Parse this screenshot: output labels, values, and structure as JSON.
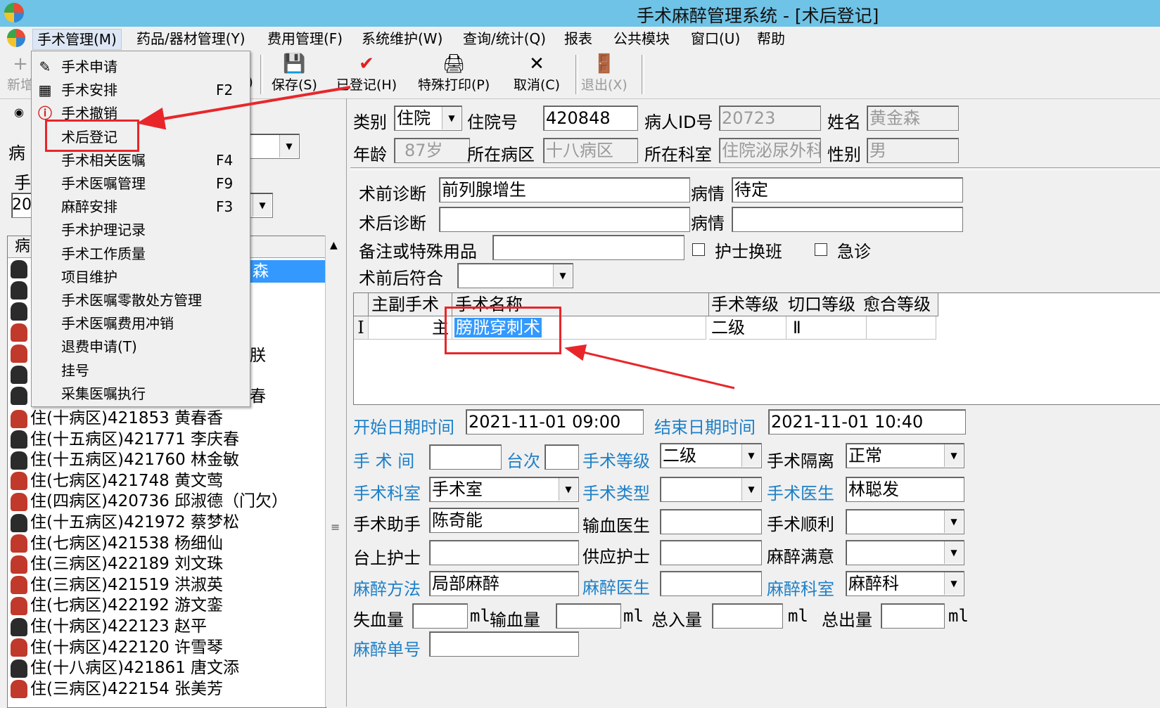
{
  "window": {
    "title": "手术麻醉管理系统 - [术后登记]"
  },
  "menubar": {
    "items": [
      "手术管理(M)",
      "药品/器材管理(Y)",
      "费用管理(F)",
      "系统维护(W)",
      "查询/统计(Q)",
      "报表",
      "公共模块",
      "窗口(U)",
      "帮助"
    ]
  },
  "toolbar": {
    "new_label": "新增",
    "edit_partial": ")",
    "save_label": "保存(S)",
    "registered_label": "已登记(H)",
    "special_print_label": "特殊打印(P)",
    "cancel_label": "取消(C)",
    "exit_label": "退出(X)"
  },
  "dropdown": {
    "items": [
      {
        "label": "手术申请",
        "shortcut": "",
        "icon": "pen-icon"
      },
      {
        "label": "手术安排",
        "shortcut": "F2",
        "icon": "qr-icon"
      },
      {
        "label": "手术撤销",
        "shortcut": "",
        "icon": "alert-icon"
      },
      {
        "label": "术后登记",
        "shortcut": "",
        "icon": ""
      },
      {
        "label": "手术相关医嘱",
        "shortcut": "F4",
        "icon": ""
      },
      {
        "label": "手术医嘱管理",
        "shortcut": "F9",
        "icon": ""
      },
      {
        "label": "麻醉安排",
        "shortcut": "F3",
        "icon": ""
      },
      {
        "label": "手术护理记录",
        "shortcut": "",
        "icon": ""
      },
      {
        "label": "手术工作质量",
        "shortcut": "",
        "icon": ""
      },
      {
        "label": "项目维护",
        "shortcut": "",
        "icon": ""
      },
      {
        "label": "手术医嘱零散处方管理",
        "shortcut": "",
        "icon": ""
      },
      {
        "label": "手术医嘱费用冲销",
        "shortcut": "",
        "icon": ""
      },
      {
        "label": "退费申请(T)",
        "shortcut": "",
        "icon": ""
      },
      {
        "label": "挂号",
        "shortcut": "",
        "icon": ""
      },
      {
        "label": "采集医嘱执行",
        "shortcut": "",
        "icon": ""
      }
    ]
  },
  "leftpanel": {
    "label_bing": "病",
    "label_shou": "手",
    "date_prefix": "20",
    "list_header": "病",
    "partial_names": [
      "森",
      "朕",
      "春"
    ],
    "patients": [
      {
        "text": "住(十病区)421853  黄春香",
        "color": "#c0392b"
      },
      {
        "text": "住(十五病区)421771  李庆春",
        "color": "#2b2b2b"
      },
      {
        "text": "住(十五病区)421760  林金敏",
        "color": "#2b2b2b"
      },
      {
        "text": "住(七病区)421748  黄文莺",
        "color": "#c0392b"
      },
      {
        "text": "住(四病区)420736  邱淑德（门欠）",
        "color": "#c0392b"
      },
      {
        "text": "住(十五病区)421972  蔡梦松",
        "color": "#2b2b2b"
      },
      {
        "text": "住(七病区)421538  杨细仙",
        "color": "#c0392b"
      },
      {
        "text": "住(三病区)422189  刘文珠",
        "color": "#c0392b"
      },
      {
        "text": "住(三病区)421519  洪淑英",
        "color": "#c0392b"
      },
      {
        "text": "住(七病区)422192  游文銮",
        "color": "#c0392b"
      },
      {
        "text": "住(十病区)422123  赵平",
        "color": "#2b2b2b"
      },
      {
        "text": "住(十病区)422120  许雪琴",
        "color": "#c0392b"
      },
      {
        "text": "住(十八病区)421861  唐文添",
        "color": "#2b2b2b"
      },
      {
        "text": "住(三病区)422154  张美芳",
        "color": "#c0392b"
      }
    ]
  },
  "patient": {
    "category_label": "类别",
    "category_value": "住院",
    "inpatient_no_label": "住院号",
    "inpatient_no": "420848",
    "patient_id_label": "病人ID号",
    "patient_id": "20723",
    "name_label": "姓名",
    "name": "黄金森",
    "age_label": "年龄",
    "age": "87岁",
    "ward_label": "所在病区",
    "ward": "十八病区",
    "dept_label": "所在科室",
    "dept": "住院泌尿外科",
    "gender_label": "性别",
    "gender": "男"
  },
  "diagnosis": {
    "pre_label": "术前诊断",
    "pre_value": "前列腺增生",
    "cond1_label": "病情",
    "cond1_value": "待定",
    "post_label": "术后诊断",
    "post_value": "",
    "cond2_label": "病情",
    "cond2_value": "",
    "remark_label": "备注或特殊用品",
    "remark_value": "",
    "nurse_shift_label": "护士换班",
    "emergency_label": "急诊",
    "match_label": "术前后符合",
    "match_value": ""
  },
  "grid": {
    "headers": [
      "主副手术",
      "手术名称",
      "手术等级",
      "切口等级",
      "愈合等级"
    ],
    "rows": [
      {
        "marker": "I",
        "main_sub": "主",
        "name": "膀胱穿刺术",
        "level": "二级",
        "incision": "Ⅱ",
        "healing": ""
      }
    ]
  },
  "details": {
    "start_label": "开始日期时间",
    "start_value": "2021-11-01  09:00",
    "end_label": "结束日期时间",
    "end_value": "2021-11-01  10:40",
    "room_label": "手  术  间",
    "room_value": "",
    "seq_label": "台次",
    "seq_value": "",
    "level_label": "手术等级",
    "level_value": "二级",
    "isolation_label": "手术隔离",
    "isolation_value": "正常",
    "surg_dept_label": "手术科室",
    "surg_dept_value": "手术室",
    "type_label": "手术类型",
    "type_value": "",
    "surgeon_label": "手术医生",
    "surgeon_value": "林聪发",
    "assistant_label": "手术助手",
    "assistant_value": "陈奇能",
    "transfusion_doc_label": "输血医生",
    "transfusion_doc_value": "",
    "smooth_label": "手术顺利",
    "smooth_value": "",
    "table_nurse_label": "台上护士",
    "table_nurse_value": "",
    "supply_nurse_label": "供应护士",
    "supply_nurse_value": "",
    "anes_satisfied_label": "麻醉满意",
    "anes_satisfied_value": "",
    "anes_method_label": "麻醉方法",
    "anes_method_value": "局部麻醉",
    "anes_doc_label": "麻醉医生",
    "anes_doc_value": "",
    "anes_dept_label": "麻醉科室",
    "anes_dept_value": "麻醉科",
    "blood_loss_label": "失血量",
    "blood_loss_value": "",
    "transfusion_label": "输血量",
    "transfusion_value": "",
    "intake_label": "总入量",
    "intake_value": "",
    "output_label": "总出量",
    "output_value": "",
    "unit_ml": "ml",
    "anes_no_label": "麻醉单号",
    "anes_no_value": ""
  },
  "colors": {
    "titlebar": "#6ec3e6",
    "annotation_red": "#e8262a",
    "label_blue": "#1e80c8",
    "selection_blue": "#3399ff"
  }
}
